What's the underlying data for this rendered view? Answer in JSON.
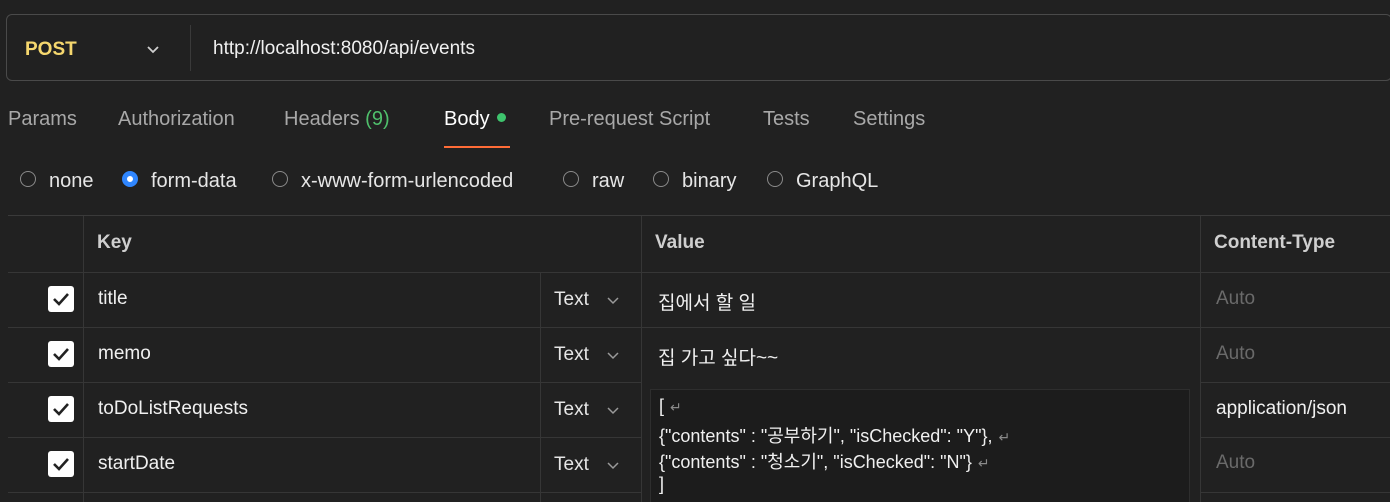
{
  "request": {
    "method": "POST",
    "url": "http://localhost:8080/api/events"
  },
  "tabs": [
    {
      "label": "Params"
    },
    {
      "label": "Authorization"
    },
    {
      "label": "Headers",
      "count": "(9)"
    },
    {
      "label": "Body"
    },
    {
      "label": "Pre-request Script"
    },
    {
      "label": "Tests"
    },
    {
      "label": "Settings"
    }
  ],
  "body_types": [
    {
      "label": "none",
      "selected": false
    },
    {
      "label": "form-data",
      "selected": true
    },
    {
      "label": "x-www-form-urlencoded",
      "selected": false
    },
    {
      "label": "raw",
      "selected": false
    },
    {
      "label": "binary",
      "selected": false
    },
    {
      "label": "GraphQL",
      "selected": false
    }
  ],
  "table": {
    "headers": {
      "key": "Key",
      "value": "Value",
      "content_type": "Content-Type"
    },
    "rows": [
      {
        "checked": true,
        "key": "title",
        "type": "Text",
        "value": "집에서 할 일",
        "content_type": "Auto"
      },
      {
        "checked": true,
        "key": "memo",
        "type": "Text",
        "value": "집 가고 싶다~~",
        "content_type": "Auto"
      },
      {
        "checked": true,
        "key": "toDoListRequests",
        "type": "Text",
        "value_lines": [
          "[",
          "{\"contents\" : \"공부하기\", \"isChecked\": \"Y\"},",
          "{\"contents\" : \"청소기\", \"isChecked\": \"N\"}",
          "]"
        ],
        "content_type": "application/json"
      },
      {
        "checked": true,
        "key": "startDate",
        "type": "Text",
        "value": "",
        "content_type": "Auto"
      }
    ]
  },
  "colors": {
    "method": "#f5d76e",
    "active_tab_underline": "#ff6c37",
    "body_dot": "#3ec46d",
    "radio_selected": "#2f86ff",
    "background": "#212121"
  }
}
